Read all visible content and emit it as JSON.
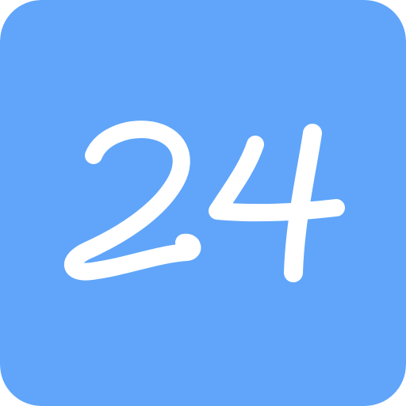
{
  "icon": {
    "name": "24-app-icon",
    "text": "24",
    "background_color": "#60a5fa",
    "foreground_color": "#ffffff"
  }
}
